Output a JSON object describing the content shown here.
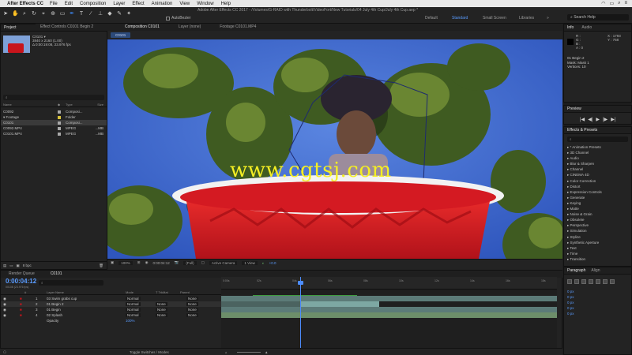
{
  "menubar": {
    "app": "After Effects CC",
    "items": [
      "File",
      "Edit",
      "Composition",
      "Layer",
      "Effect",
      "Animation",
      "View",
      "Window",
      "Help"
    ]
  },
  "toolbar": {
    "title": "Adobe After Effects CC 2017 - /Volumes/G-RAID with Thunderbolt/VideoFort/New Tutorials/04 July 4th Cup/July 4th Cup.aep *",
    "snap_label": "AutoBezier",
    "workspaces": [
      "Default",
      "Standard",
      "Small Screen",
      "Libraries"
    ],
    "active_workspace": "Standard",
    "search_placeholder": "Search Help"
  },
  "project": {
    "tab": "Project",
    "fx_tab": "Effect Controls C0101 Begin 2",
    "item_name": "C0101 ▾",
    "item_size": "3840 x 2160 (1.00)",
    "item_duration": "Δ 0:00:19:08, 23.976 fps",
    "search_placeholder": "⌕",
    "columns": [
      "Name",
      "",
      "Type",
      "Size"
    ],
    "rows": [
      {
        "name": "C0092",
        "type": "Composi...",
        "size": "",
        "color": "#a9a9a9"
      },
      {
        "name": "▾ Footage",
        "type": "Folder",
        "size": "",
        "color": "#d9c33b"
      },
      {
        "name": "  C0101",
        "type": "Composi...",
        "size": "",
        "color": "#a9a9a9"
      },
      {
        "name": "  C0092.MP4",
        "type": "MPEG",
        "size": "...MB",
        "color": "#a9a9a9"
      },
      {
        "name": "  C0101.MP4",
        "type": "MPEG",
        "size": "...MB",
        "color": "#a9a9a9"
      }
    ],
    "bpc": "8 bpc"
  },
  "comp": {
    "tabs": [
      "Composition C0101",
      "Layer (none)",
      "Footage C0101.MP4"
    ],
    "crumb": "C0101",
    "watermark": "www.cgtsj.com",
    "footer": {
      "zoom": "100%",
      "timecode": "0:00:04:12",
      "resolution": "(Full)",
      "camera": "Active Camera",
      "views": "1 View",
      "exposure": "+0.0"
    }
  },
  "info": {
    "tabs": [
      "Info",
      "Audio"
    ],
    "rgba": [
      "R :",
      "G :",
      "B :",
      "A : 0"
    ],
    "xy": [
      "X : 1793",
      "Y : 758"
    ],
    "lines": [
      "01 Begin 2",
      "Mask: Mask 1",
      "Vertices: 10"
    ]
  },
  "preview": {
    "tab": "Preview",
    "controls": [
      "|◀",
      "◀|",
      "▶",
      "|▶",
      "▶|"
    ]
  },
  "effects": {
    "tab": "Effects & Presets",
    "search_placeholder": "⌕",
    "items": [
      "▸ * Animation Presets",
      "▸ 3D Channel",
      "▸ Audio",
      "▸ Blur & Sharpen",
      "▸ Channel",
      "▸ CINEMA 4D",
      "▸ Color Correction",
      "▸ Distort",
      "▸ Expression Controls",
      "▸ Generate",
      "▸ Keying",
      "▸ Matte",
      "▸ Noise & Grain",
      "▸ Obsolete",
      "▸ Perspective",
      "▸ Simulation",
      "▸ Stylize",
      "▸ Synthetic Aperture",
      "▸ Text",
      "▸ Time",
      "▸ Transition"
    ]
  },
  "timeline": {
    "tabs": [
      "Render Queue",
      "C0101"
    ],
    "timecode": "0:00:04:12",
    "timecode_sub": "00108 (23.976 fps)",
    "headers": [
      "#",
      "Layer Name",
      "Mode",
      "T TrkMat",
      "Parent"
    ],
    "layers": [
      {
        "num": "1",
        "name": "03 Swim grabs cup",
        "mode": "Normal",
        "trkmat": "",
        "parent": "None"
      },
      {
        "num": "2",
        "name": "01 Begin 2",
        "mode": "Normal",
        "trkmat": "None",
        "parent": "None"
      },
      {
        "num": "3",
        "name": "01 Begin",
        "mode": "Normal",
        "trkmat": "None",
        "parent": "None"
      },
      {
        "num": "4",
        "name": "02 Splash",
        "mode": "Normal",
        "trkmat": "None",
        "parent": "None"
      }
    ],
    "opacity_label": "Opacity",
    "opacity_value": "100%",
    "ruler": [
      "0:00s",
      "02s",
      "04s",
      "06s",
      "08s",
      "10s",
      "12s",
      "14s",
      "16s",
      "18s"
    ],
    "footer": "Toggle Switches / Modes"
  },
  "paragraph": {
    "tabs": [
      "Paragraph",
      "Align"
    ],
    "fields": [
      "0 px",
      "0 px",
      "0 px",
      "0 px",
      "0 px"
    ]
  },
  "colors": {
    "accent": "#4d8dff",
    "label_red": "#c8151c",
    "track_teal": "#5c7b78",
    "track_green": "#6d8e6a"
  }
}
